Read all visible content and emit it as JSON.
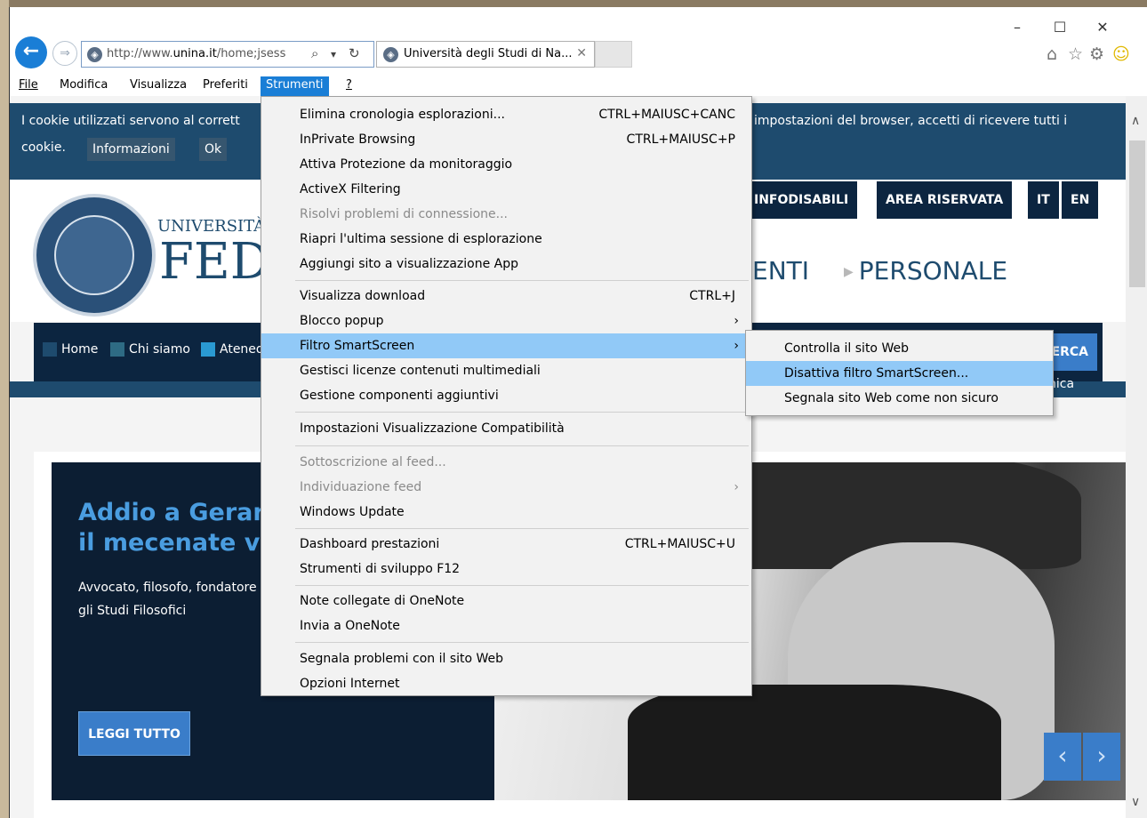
{
  "window": {
    "controls": [
      "–",
      "☐",
      "✕"
    ]
  },
  "nav": {
    "back_icon": "back-arrow-icon",
    "forward_icon": "forward-arrow-icon"
  },
  "address_bar": {
    "url_prefix": "http://www.",
    "url_domain": "unina.it",
    "url_suffix": "/home;jsess",
    "search_icon": "⌕",
    "dropdown_icon": "▾",
    "refresh_icon": "↻"
  },
  "tab": {
    "title": "Università degli Studi di Na...",
    "close": "✕"
  },
  "toolbar_icons": [
    "⌂",
    "☆",
    "⚙",
    "☺"
  ],
  "menubar": {
    "items": [
      {
        "label": "File",
        "active": false
      },
      {
        "label": "Modifica",
        "active": false
      },
      {
        "label": "Visualizza",
        "active": false
      },
      {
        "label": "Preferiti",
        "active": false
      },
      {
        "label": "Strumenti",
        "active": true
      },
      {
        "label": "?",
        "active": false
      }
    ]
  },
  "cookie_banner": {
    "text_left": "I cookie utilizzati servono al corrett",
    "text_right": "impostazioni del browser, accetti di ricevere tutti i",
    "text_line2": "cookie.",
    "info_button": "Informazioni",
    "ok_button": "Ok"
  },
  "site": {
    "brand_line1": "UNIVERSITÀ D",
    "brand_line2": "FEDE",
    "top_nav": [
      "INFODISABILI",
      "AREA RISERVATA",
      "IT",
      "EN"
    ],
    "big_nav": [
      "ENTI",
      "PERSONALE"
    ],
    "main_nav": [
      "Home",
      "Chi siamo",
      "Ateneo"
    ],
    "search_label": "ERCA",
    "stripe_tag": "nica"
  },
  "hero": {
    "title_line1": "Addio a Gerarc",
    "title_line2": "il mecenate vi",
    "subtitle_line1": "Avvocato, filosofo, fondatore",
    "subtitle_line2": "gli Studi Filosofici",
    "button": "LEGGI TUTTO",
    "prev": "‹",
    "next": "›"
  },
  "tools_menu": {
    "items": [
      {
        "label": "Elimina cronologia esplorazioni...",
        "shortcut": "CTRL+MAIUSC+CANC",
        "disabled": false
      },
      {
        "label": "InPrivate Browsing",
        "shortcut": "CTRL+MAIUSC+P",
        "disabled": false
      },
      {
        "label": "Attiva Protezione da monitoraggio",
        "shortcut": "",
        "disabled": false
      },
      {
        "label": "ActiveX Filtering",
        "shortcut": "",
        "disabled": false
      },
      {
        "label": "Risolvi problemi di connessione...",
        "shortcut": "",
        "disabled": true
      },
      {
        "label": "Riapri l'ultima sessione di esplorazione",
        "shortcut": "",
        "disabled": false
      },
      {
        "label": "Aggiungi sito a visualizzazione App",
        "shortcut": "",
        "disabled": false
      },
      {
        "label": "Visualizza download",
        "shortcut": "CTRL+J",
        "disabled": false
      },
      {
        "label": "Blocco popup",
        "shortcut": "",
        "submenu": true,
        "disabled": false
      },
      {
        "label": "Filtro SmartScreen",
        "shortcut": "",
        "submenu": true,
        "disabled": false,
        "highlighted": true
      },
      {
        "label": "Gestisci licenze contenuti multimediali",
        "shortcut": "",
        "disabled": false
      },
      {
        "label": "Gestione componenti aggiuntivi",
        "shortcut": "",
        "disabled": false
      },
      {
        "label": "Impostazioni Visualizzazione Compatibilità",
        "shortcut": "",
        "disabled": false
      },
      {
        "label": "Sottoscrizione al feed...",
        "shortcut": "",
        "disabled": true
      },
      {
        "label": "Individuazione feed",
        "shortcut": "",
        "submenu": true,
        "disabled": true
      },
      {
        "label": "Windows Update",
        "shortcut": "",
        "disabled": false
      },
      {
        "label": "Dashboard prestazioni",
        "shortcut": "CTRL+MAIUSC+U",
        "disabled": false
      },
      {
        "label": "Strumenti di sviluppo F12",
        "shortcut": "",
        "disabled": false
      },
      {
        "label": "Note collegate di OneNote",
        "shortcut": "",
        "disabled": false
      },
      {
        "label": "Invia a OneNote",
        "shortcut": "",
        "disabled": false
      },
      {
        "label": "Segnala problemi con il sito Web",
        "shortcut": "",
        "disabled": false
      },
      {
        "label": "Opzioni Internet",
        "shortcut": "",
        "disabled": false
      }
    ]
  },
  "smartscreen_submenu": {
    "items": [
      {
        "label": "Controlla il sito Web",
        "highlighted": false
      },
      {
        "label": "Disattiva filtro SmartScreen...",
        "highlighted": true
      },
      {
        "label": "Segnala sito Web come non sicuro",
        "highlighted": false
      }
    ]
  },
  "colors": {
    "accent": "#1a7ed6",
    "menu_highlight": "#91c9f7",
    "navy": "#0c2540",
    "banner": "#1e4b6e",
    "hero_title": "#4a9de0"
  }
}
